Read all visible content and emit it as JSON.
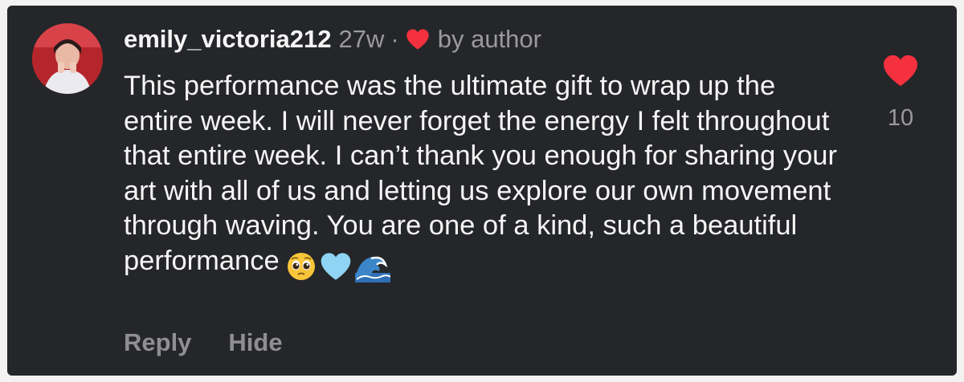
{
  "comment": {
    "username": "emily_victoria212",
    "age": "27w",
    "separator": "·",
    "author_badge_text": "by author",
    "author_badge_icon": "heart-icon",
    "text": "This performance was the ultimate gift to wrap up the entire week. I will never forget the energy I felt throughout that entire week. I can’t thank you enough for sharing your art with all of us and letting us explore our own movement through waving. You are one of a kind, such a beautiful performance",
    "emojis": [
      "pleading-face-emoji",
      "light-blue-heart-emoji",
      "water-wave-emoji"
    ],
    "like_icon": "heart-icon",
    "like_count": "10",
    "actions": {
      "reply": "Reply",
      "hide": "Hide"
    }
  },
  "colors": {
    "card_background": "#252629",
    "text_primary": "#f5f5f5",
    "text_secondary": "#9a9a9e",
    "heart_red": "#f5303f",
    "avatar_red": "#b5262c"
  }
}
